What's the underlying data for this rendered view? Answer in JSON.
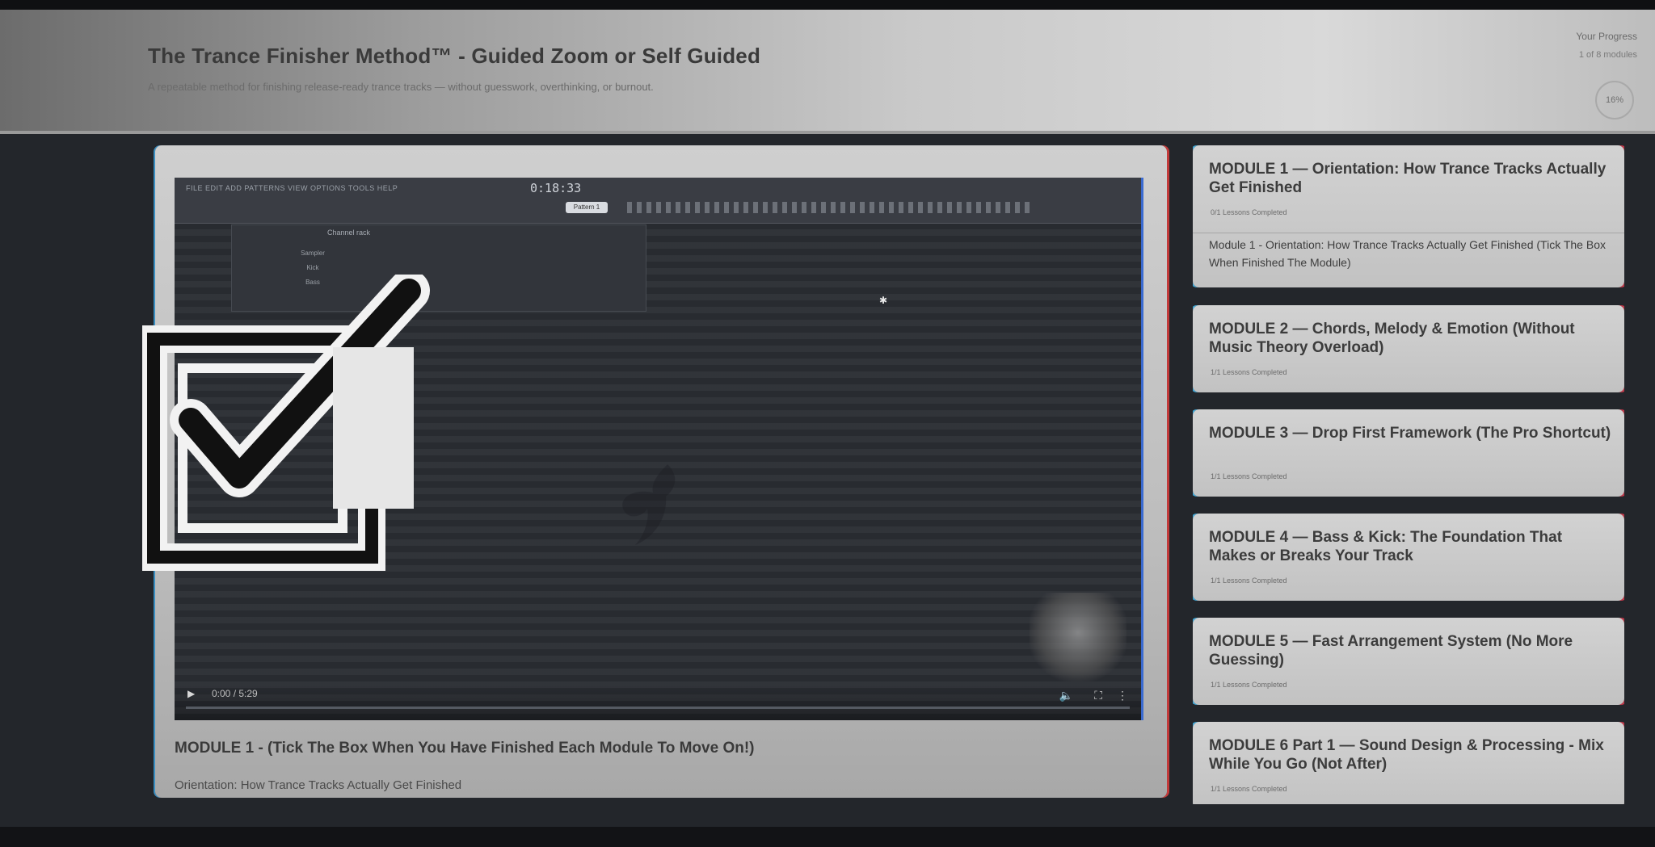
{
  "header": {
    "title": "The Trance Finisher Method™ - Guided Zoom or Self Guided",
    "subtitle": "A repeatable method for finishing release-ready trance tracks — without guesswork, overthinking, or burnout.",
    "progress_label": "Your Progress",
    "progress_sub": "1 of 8 modules",
    "progress_percent": "16%"
  },
  "video": {
    "time": "0:00 / 5:29",
    "progress": 0,
    "daw_menu": "FILE EDIT ADD PATTERNS VIEW OPTIONS TOOLS HELP",
    "daw_time": "0:18:33",
    "daw_pattern": "Pattern 1",
    "channel_rack_title": "Channel rack",
    "rack_rows": [
      "Sampler",
      "Kick",
      "Bass"
    ]
  },
  "main": {
    "lesson_title": "MODULE 1 - (Tick The Box When You Have Finished Each Module To Move On!)",
    "lesson_subtitle": "Orientation: How Trance Tracks Actually Get Finished"
  },
  "modules": [
    {
      "title": "MODULE 1 — Orientation: How Trance Tracks Actually Get Finished",
      "progress": "0/1 Lessons Completed",
      "lesson": "Module 1 - Orientation: How Trance Tracks Actually Get Finished (Tick The Box When Finished The Module)"
    },
    {
      "title": "MODULE 2 — Chords, Melody & Emotion (Without Music Theory Overload)",
      "progress": "1/1 Lessons Completed"
    },
    {
      "title": "MODULE 3 — Drop First Framework (The Pro Shortcut)",
      "progress": "1/1 Lessons Completed"
    },
    {
      "title": "MODULE 4 — Bass & Kick: The Foundation That Makes or Breaks Your Track",
      "progress": "1/1 Lessons Completed"
    },
    {
      "title": "MODULE 5 — Fast Arrangement System (No More Guessing)",
      "progress": "1/1 Lessons Completed"
    },
    {
      "title": "MODULE 6 Part 1 — Sound Design & Processing - Mix While You Go (Not After)",
      "progress": "1/1 Lessons Completed"
    }
  ],
  "colors": {
    "accent_left": "#3fa7d6",
    "accent_right": "#c2394a"
  },
  "icons": {
    "play": "play-icon",
    "volume": "volume-icon",
    "fullscreen": "fullscreen-icon",
    "more": "more-icon",
    "checkbox": "checkbox-checked-icon"
  }
}
